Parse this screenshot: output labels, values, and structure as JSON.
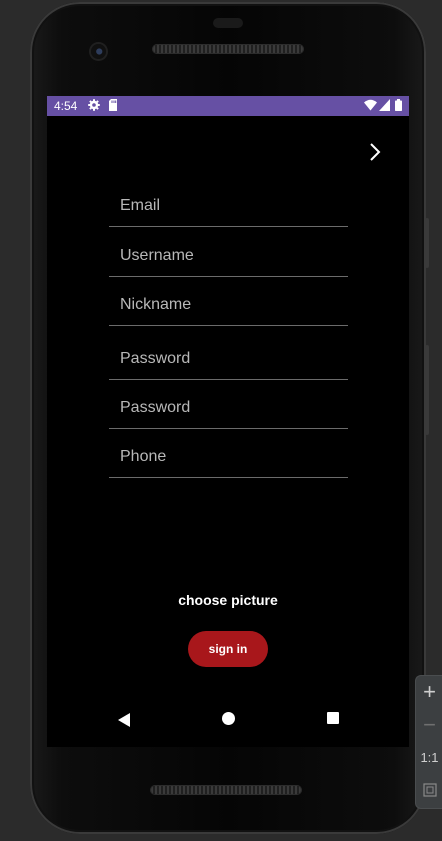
{
  "status_bar": {
    "time": "4:54",
    "left_icons": [
      "gear-icon",
      "sd-card-icon"
    ],
    "right_icons": [
      "wifi-icon",
      "signal-icon",
      "battery-icon"
    ],
    "color": "#6650a4"
  },
  "form": {
    "next_icon": "chevron-right-icon",
    "fields": [
      {
        "name": "email",
        "placeholder": "Email"
      },
      {
        "name": "username",
        "placeholder": "Username"
      },
      {
        "name": "nickname",
        "placeholder": "Nickname"
      },
      {
        "name": "password",
        "placeholder": "Password"
      },
      {
        "name": "password-confirm",
        "placeholder": "Password"
      },
      {
        "name": "phone",
        "placeholder": "Phone"
      }
    ],
    "choose_picture_label": "choose picture",
    "sign_in_label": "sign in",
    "sign_in_color": "#a8171b"
  },
  "nav_bar": {
    "icons": [
      "back-icon",
      "home-icon",
      "recents-icon"
    ]
  },
  "zoom_controls": {
    "zoom_in": "+",
    "zoom_out": "−",
    "actual_size": "1:1",
    "fit_icon": "fit-screen-icon"
  }
}
